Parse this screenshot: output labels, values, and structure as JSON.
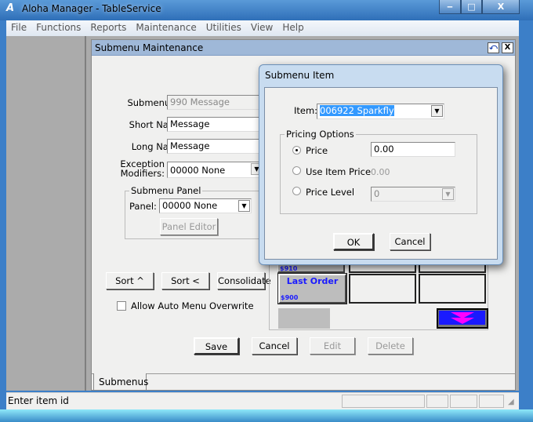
{
  "window": {
    "title": "Aloha Manager - TableService",
    "minimize": "‒",
    "maximize": "□",
    "close": "X"
  },
  "menubar": [
    "File",
    "Functions",
    "Reports",
    "Maintenance",
    "Utilities",
    "View",
    "Help"
  ],
  "child": {
    "title": "Submenu Maintenance",
    "restore": "⤺",
    "close": "X",
    "submenu_id_label": "Submenu ID:",
    "submenu_id_value": "990 Message",
    "short_name_label": "Short Name:",
    "short_name_value": "Message",
    "long_name_label": "Long Name:",
    "long_name_value": "Message",
    "exception_label_1": "Exception",
    "exception_label_2": "Modifiers:",
    "exception_value": "00000 None",
    "panel_group": "Submenu Panel",
    "panel_label": "Panel:",
    "panel_value": "00000 None",
    "panel_editor": "Panel Editor",
    "sort_up": "Sort ^",
    "sort_left": "Sort <",
    "consolidate": "Consolidate",
    "allow_auto": "Allow Auto Menu Overwrite",
    "allow_auto_checked": false,
    "save": "Save",
    "cancel": "Cancel",
    "edit": "Edit",
    "delete": "Delete",
    "tab": "Submenus",
    "grid": {
      "button1_number": "$910",
      "button2_label": "Last Order",
      "button2_number": "$900",
      "accent": "#1a1aff",
      "arrow_color": "#ff00ff"
    }
  },
  "dialog": {
    "title": "Submenu Item",
    "item_label": "Item:",
    "item_value": "006922 Sparkfly",
    "pricing_group": "Pricing Options",
    "price_label": "Price",
    "price_value": "0.00",
    "use_item_price_label": "Use Item Price",
    "use_item_price_value": "0.00",
    "price_level_label": "Price Level",
    "price_level_value": "0",
    "selected": "Price",
    "ok": "OK",
    "cancel": "Cancel"
  },
  "status": {
    "text": "Enter item id"
  }
}
